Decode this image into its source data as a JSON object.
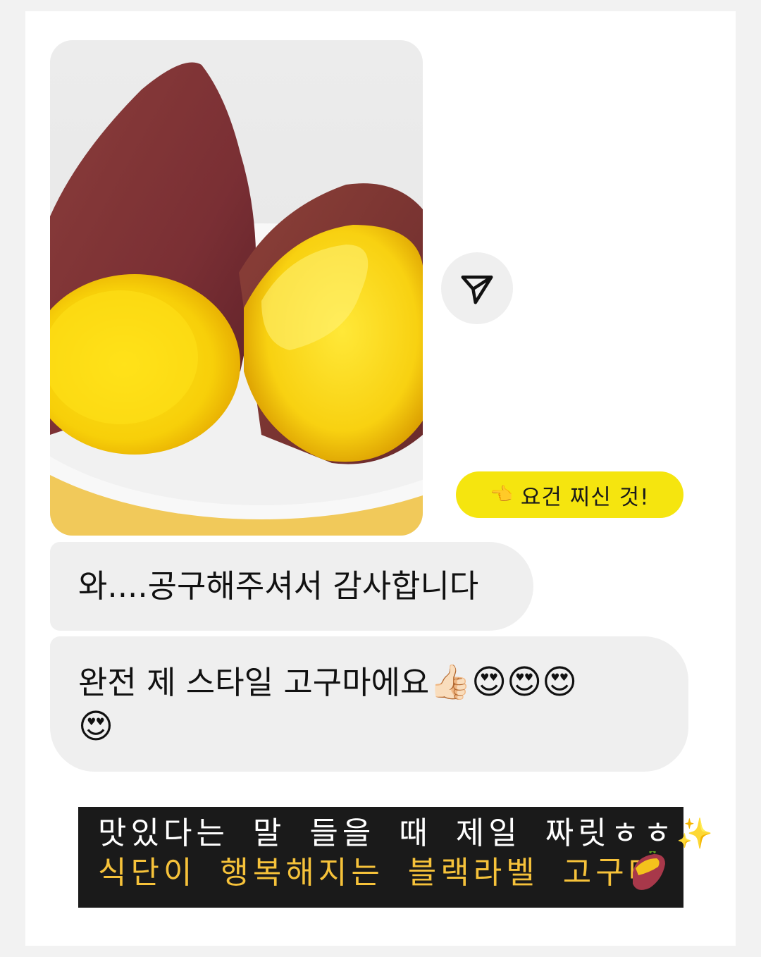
{
  "photo": {
    "alt": "sweet potatoes on a plate"
  },
  "share": {
    "icon": "send-icon"
  },
  "reply": {
    "hand": "👈",
    "text": "요건 찌신 것!"
  },
  "messages": [
    {
      "text": "와....공구해주셔서 감사합니다"
    },
    {
      "text": "완전 제 스타일 고구마에요",
      "emojis": "👍🏻😍😍😍",
      "emoji_last": "😍"
    }
  ],
  "caption": {
    "line1": "맛있다는 말 들을 때 제일 짜릿ㅎㅎ",
    "sparkle": "✨",
    "line2": "식단이 행복해지는 블랙라벨 고구마"
  },
  "colors": {
    "chip": "#f5e50f",
    "bubble": "#efefef",
    "caption_bg": "#1a1a1a",
    "caption_highlight": "#f6c23a"
  }
}
